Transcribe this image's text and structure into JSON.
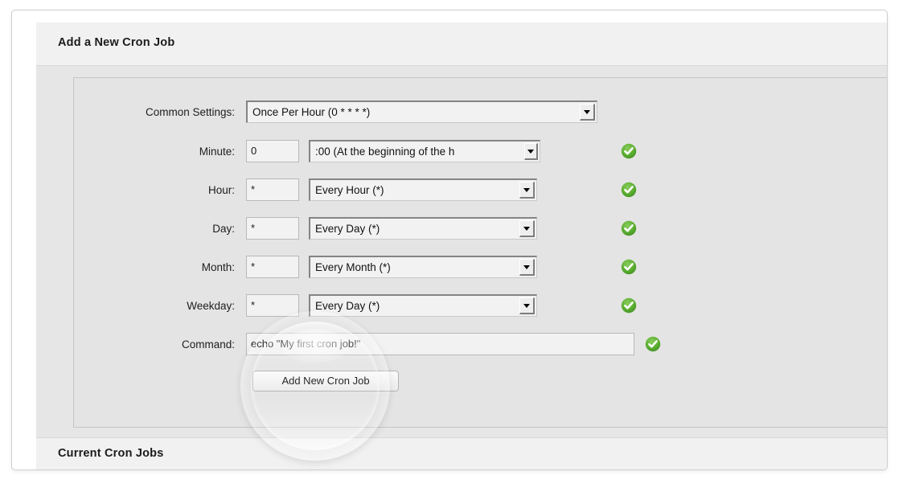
{
  "page": {
    "section_title": "Add a New Cron Job",
    "bottom_section_title": "Current Cron Jobs"
  },
  "form": {
    "rows": [
      {
        "label": "Common Settings:",
        "select_value": "Once Per Hour (0 * * * *)",
        "has_text_input": false,
        "text_value": "",
        "status": "valid",
        "has_status": false
      },
      {
        "label": "Minute:",
        "text_value": "0",
        "select_value": ":00 (At the beginning of the h",
        "has_text_input": true,
        "status": "valid",
        "has_status": true
      },
      {
        "label": "Hour:",
        "text_value": "*",
        "select_value": "Every Hour (*)",
        "has_text_input": true,
        "status": "valid",
        "has_status": true
      },
      {
        "label": "Day:",
        "text_value": "*",
        "select_value": "Every Day (*)",
        "has_text_input": true,
        "status": "valid",
        "has_status": true
      },
      {
        "label": "Month:",
        "text_value": "*",
        "select_value": "Every Month (*)",
        "has_text_input": true,
        "status": "valid",
        "has_status": true
      },
      {
        "label": "Weekday:",
        "text_value": "*",
        "select_value": "Every Day (*)",
        "has_text_input": true,
        "status": "valid",
        "has_status": true
      }
    ],
    "command": {
      "label": "Command:",
      "value": "echo \"My first cron job!\"",
      "status": "valid"
    },
    "submit_label": "Add New Cron Job"
  },
  "icons": {
    "status_valid": "check-circle-icon",
    "dropdown": "chevron-down-icon"
  },
  "colors": {
    "status_valid_green": "#4ea32b",
    "panel_gray": "#e6e6e6",
    "header_gray": "#f1f1f1",
    "fieldset_gray": "#e4e4e4",
    "input_bg": "#f2f2f2",
    "text": "#1b1b1b"
  }
}
